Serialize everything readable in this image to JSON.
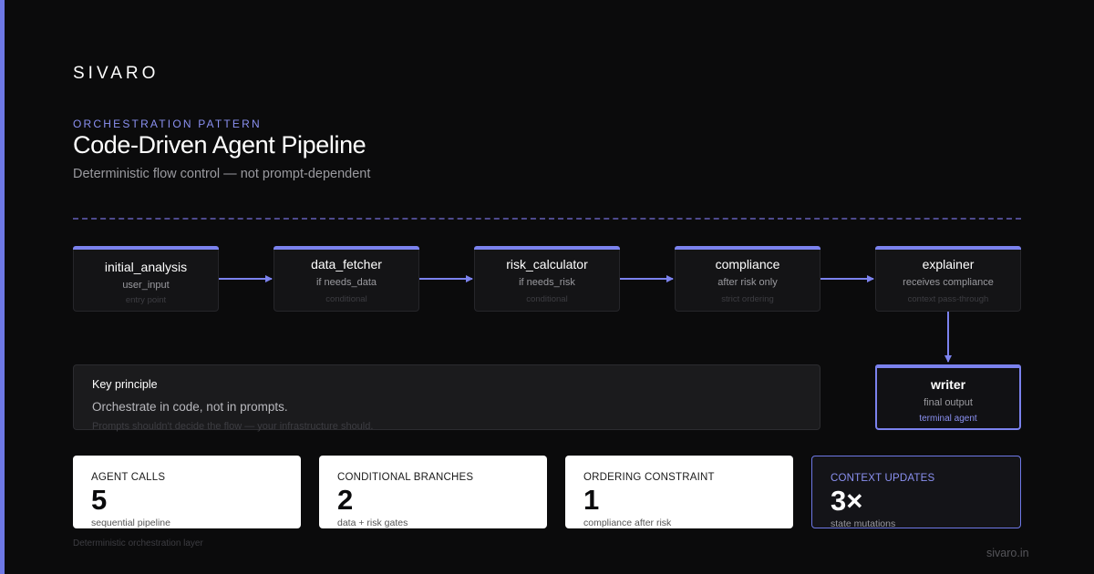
{
  "brand": "SIVARO",
  "eyebrow": "ORCHESTRATION PATTERN",
  "title": "Code-Driven Agent Pipeline",
  "subtitle": "Deterministic flow control — not prompt-dependent",
  "colors": {
    "accent": "#7b82ee",
    "background": "#0b0b0c",
    "card": "#141416",
    "divider": "#4e4a8e"
  },
  "pipeline": [
    {
      "name": "initial_analysis",
      "desc": "user_input",
      "note": "entry point"
    },
    {
      "name": "data_fetcher",
      "desc": "if needs_data",
      "note": "conditional"
    },
    {
      "name": "risk_calculator",
      "desc": "if needs_risk",
      "note": "conditional"
    },
    {
      "name": "compliance",
      "desc": "after risk only",
      "note": "strict ordering"
    },
    {
      "name": "explainer",
      "desc": "receives compliance",
      "note": "context pass-through"
    }
  ],
  "terminal": {
    "name": "writer",
    "desc": "final output",
    "note": "terminal agent"
  },
  "principle": {
    "label": "Key principle",
    "main": "Orchestrate in code, not in prompts.",
    "sub": "Prompts shouldn't decide the flow — your infrastructure should."
  },
  "stats": [
    {
      "label": "AGENT CALLS",
      "value": "5",
      "sub": "sequential pipeline"
    },
    {
      "label": "CONDITIONAL BRANCHES",
      "value": "2",
      "sub": "data + risk gates"
    },
    {
      "label": "ORDERING CONSTRAINT",
      "value": "1",
      "sub": "compliance after risk"
    },
    {
      "label": "CONTEXT UPDATES",
      "value": "3×",
      "sub": "state mutations"
    }
  ],
  "footer": {
    "left": "Deterministic orchestration layer",
    "right": "sivaro.in"
  }
}
